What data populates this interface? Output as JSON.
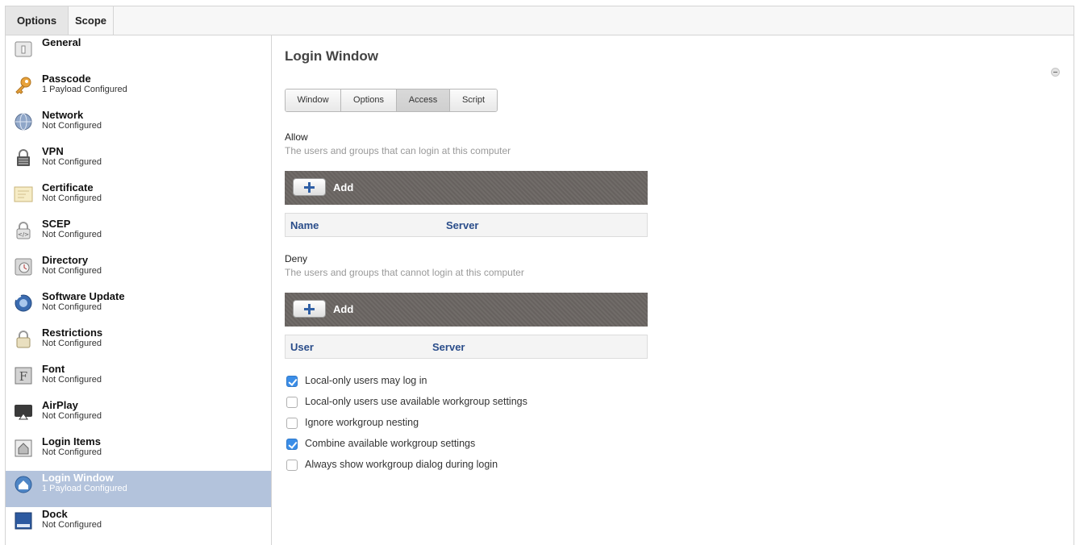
{
  "tabs": [
    {
      "label": "Options",
      "active": true
    },
    {
      "label": "Scope",
      "active": false
    }
  ],
  "sidebar": {
    "items": [
      {
        "label": "General",
        "sub": "",
        "icon": "general-icon"
      },
      {
        "label": "Passcode",
        "sub": "1 Payload Configured",
        "icon": "key-icon"
      },
      {
        "label": "Network",
        "sub": "Not Configured",
        "icon": "globe-icon"
      },
      {
        "label": "VPN",
        "sub": "Not Configured",
        "icon": "vpn-lock-icon"
      },
      {
        "label": "Certificate",
        "sub": "Not Configured",
        "icon": "certificate-icon"
      },
      {
        "label": "SCEP",
        "sub": "Not Configured",
        "icon": "scep-lock-icon"
      },
      {
        "label": "Directory",
        "sub": "Not Configured",
        "icon": "directory-icon"
      },
      {
        "label": "Software Update",
        "sub": "Not Configured",
        "icon": "software-update-icon"
      },
      {
        "label": "Restrictions",
        "sub": "Not Configured",
        "icon": "restrictions-lock-icon"
      },
      {
        "label": "Font",
        "sub": "Not Configured",
        "icon": "font-icon"
      },
      {
        "label": "AirPlay",
        "sub": "Not Configured",
        "icon": "airplay-icon"
      },
      {
        "label": "Login Items",
        "sub": "Not Configured",
        "icon": "login-items-icon"
      },
      {
        "label": "Login Window",
        "sub": "1 Payload Configured",
        "icon": "login-window-icon",
        "selected": true
      },
      {
        "label": "Dock",
        "sub": "Not Configured",
        "icon": "dock-icon"
      }
    ]
  },
  "main": {
    "title": "Login Window",
    "segments": [
      {
        "label": "Window",
        "active": false
      },
      {
        "label": "Options",
        "active": false
      },
      {
        "label": "Access",
        "active": true
      },
      {
        "label": "Script",
        "active": false
      }
    ],
    "allow": {
      "title": "Allow",
      "description": "The users and groups that can login at this computer",
      "add_label": "Add",
      "columns": [
        "Name",
        "Server"
      ]
    },
    "deny": {
      "title": "Deny",
      "description": "The users and groups that cannot login at this computer",
      "add_label": "Add",
      "columns": [
        "User",
        "Server"
      ]
    },
    "checkboxes": [
      {
        "label": "Local-only users may log in",
        "checked": true
      },
      {
        "label": "Local-only users use available workgroup settings",
        "checked": false
      },
      {
        "label": "Ignore workgroup nesting",
        "checked": false
      },
      {
        "label": "Combine available workgroup settings",
        "checked": true
      },
      {
        "label": "Always show workgroup dialog during login",
        "checked": false
      }
    ]
  },
  "colors": {
    "selected_bg": "#b3c3dc",
    "header_text": "#2a4d8a",
    "checkbox_checked": "#3b8ee8",
    "add_bar": "#6b6663"
  }
}
